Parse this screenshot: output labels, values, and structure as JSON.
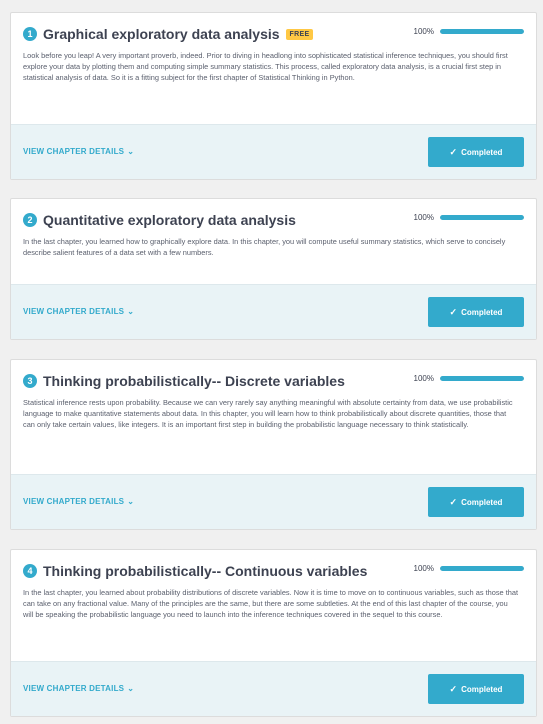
{
  "chapters": [
    {
      "number": "1",
      "title": "Graphical exploratory data analysis",
      "badge": "FREE",
      "progress_text": "100%",
      "progress": 1.0,
      "description": "Look before you leap! A very important proverb, indeed. Prior to diving in headlong into sophisticated statistical inference techniques, you should first explore your data by plotting them and computing simple summary statistics. This process, called exploratory data analysis, is a crucial first step in statistical analysis of data. So it is a fitting subject for the first chapter of Statistical Thinking in Python.",
      "details_label": "VIEW CHAPTER DETAILS",
      "status_label": "Completed"
    },
    {
      "number": "2",
      "title": "Quantitative exploratory data analysis",
      "progress_text": "100%",
      "progress": 1.0,
      "description": "In the last chapter, you learned how to graphically explore data. In this chapter, you will compute useful summary statistics, which serve to concisely describe salient features of a data set with a few numbers.",
      "details_label": "VIEW CHAPTER DETAILS",
      "status_label": "Completed"
    },
    {
      "number": "3",
      "title": "Thinking probabilistically-- Discrete variables",
      "progress_text": "100%",
      "progress": 1.0,
      "description": "Statistical inference rests upon probability. Because we can very rarely say anything meaningful with absolute certainty from data, we use probabilistic language to make quantitative statements about data. In this chapter, you will learn how to think probabilistically about discrete quantities, those that can only take certain values, like integers. It is an important first step in building the probabilistic language necessary to think statistically.",
      "details_label": "VIEW CHAPTER DETAILS",
      "status_label": "Completed"
    },
    {
      "number": "4",
      "title": "Thinking probabilistically-- Continuous variables",
      "progress_text": "100%",
      "progress": 1.0,
      "description": "In the last chapter, you learned about probability distributions of discrete variables. Now it is time to move on to continuous variables, such as those that can take on any fractional value. Many of the principles are the same, but there are some subtleties. At the end of this last chapter of the course, you will be speaking the probabilistic language you need to launch into the inference techniques covered in the sequel to this course.",
      "details_label": "VIEW CHAPTER DETAILS",
      "status_label": "Completed"
    }
  ],
  "icons": {
    "check": "check-icon",
    "chevron": "chevron-down-icon"
  },
  "colors": {
    "accent": "#33aacc",
    "badge": "#ffc844",
    "footer": "#e9f3f6"
  }
}
